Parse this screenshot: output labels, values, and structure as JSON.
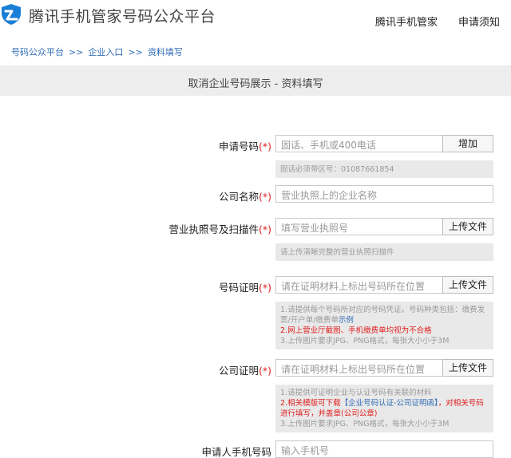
{
  "header": {
    "site_title": "腾讯手机管家号码公众平台",
    "nav": [
      "腾讯手机管家",
      "申请须知"
    ]
  },
  "breadcrumb": [
    "号码公众平台",
    "企业入口",
    "资料填写"
  ],
  "breadcrumb_sep": ">>",
  "page_title": "取消企业号码展示 - 资料填写",
  "required_mark": "(*)",
  "form": {
    "apply_number": {
      "label": "申请号码",
      "placeholder": "固话、手机或400电话",
      "button": "增加",
      "hint": "固话必须带区号：01087661854"
    },
    "company_name": {
      "label": "公司名称",
      "placeholder": "营业执照上的企业名称"
    },
    "license": {
      "label": "营业执照号及扫描件",
      "placeholder": "填写营业执照号",
      "button": "上传文件",
      "hint": "请上传清晰完整的营业执照扫描件"
    },
    "number_proof": {
      "label": "号码证明",
      "placeholder": "请在证明材料上标出号码所在位置",
      "button": "上传文件",
      "hint_1": "1.请提供每个号码所对应的号码凭证。号码种类包括：缴费发票/开户单/缴费单",
      "hint_1_link": "示例",
      "hint_2": "2.网上营业厅截图、手机缴费单均视为不合格",
      "hint_3": "3.上传图片要求JPG、PNG格式，每张大小小于3M"
    },
    "company_proof": {
      "label": "公司证明",
      "placeholder": "请在证明材料上标出号码所在位置",
      "button": "上传文件",
      "hint_1": "1.请提供可证明企业与认证号码有关联的材料",
      "hint_2a": "2.相关模版可下载",
      "hint_2_link": "【企业号码认证-公司证明函】",
      "hint_2b": "，对相关号码进行填写，并盖章(公司公章)",
      "hint_3": "3.上传图片要求JPG、PNG格式，每张大小小于3M"
    },
    "applicant_phone": {
      "label": "申请人手机号码",
      "placeholder": "输入手机号"
    }
  },
  "colors": {
    "brand_blue": "#1a7fd6",
    "link_blue": "#2f6bb4",
    "required_red": "#e02020",
    "banner_gray": "#ededed"
  }
}
